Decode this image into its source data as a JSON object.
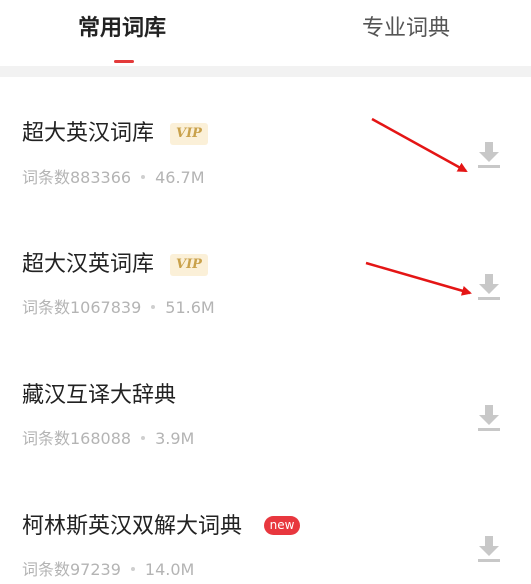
{
  "tabs": [
    {
      "label": "常用词库",
      "active": true
    },
    {
      "label": "专业词典",
      "active": false
    }
  ],
  "items": [
    {
      "title": "超大英汉词库",
      "badge": "VIP",
      "count_text": "词条数883366",
      "size": "46.7M"
    },
    {
      "title": "超大汉英词库",
      "badge": "VIP",
      "count_text": "词条数1067839",
      "size": "51.6M"
    },
    {
      "title": "藏汉互译大辞典",
      "badge": "",
      "count_text": "词条数168088",
      "size": "3.9M"
    },
    {
      "title": "柯林斯英汉双解大词典",
      "badge": "new",
      "count_text": "词条数97239",
      "size": "14.0M"
    }
  ],
  "colors": {
    "accent": "#e33a3a",
    "vip_bg": "#fbf0d8",
    "vip_text": "#c9a14a",
    "new_bg": "#e8373e",
    "icon_gray": "#c8c8c8"
  },
  "icons": {
    "download": "download-icon"
  }
}
